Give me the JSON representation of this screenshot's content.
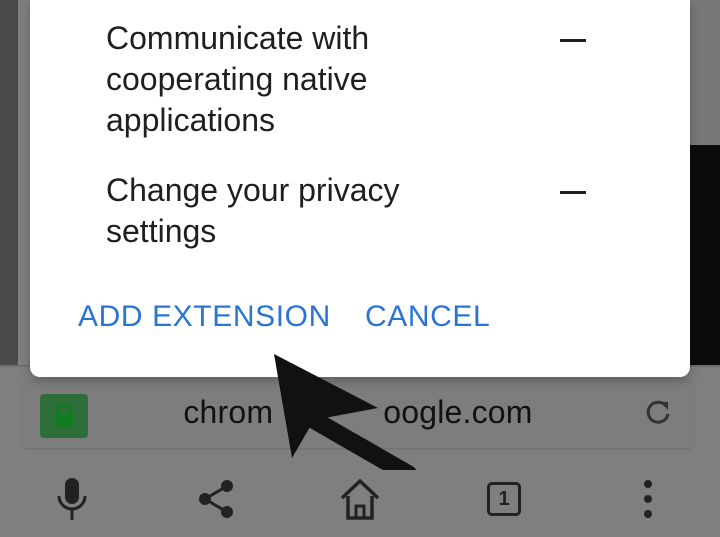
{
  "dialog": {
    "permissions": [
      {
        "label": "Communicate with cooperating native applications",
        "lines": [
          "Communicate with",
          "cooperating native",
          "applications"
        ]
      },
      {
        "label": "Change your privacy settings",
        "lines": [
          "Change your privacy",
          "settings"
        ]
      }
    ],
    "add_label": "ADD EXTENSION",
    "cancel_label": "CANCEL"
  },
  "url_bar": {
    "url_visible_left": "chrom",
    "url_visible_right": "oogle.com"
  },
  "toolbar": {
    "tab_count": "1",
    "icons": [
      "mic-icon",
      "share-icon",
      "home-icon",
      "tabs-icon",
      "more-icon"
    ]
  },
  "colors": {
    "accent": "#2a74d6",
    "lock_bg": "#2e6e3a",
    "scrim": "#7f7f7f"
  }
}
